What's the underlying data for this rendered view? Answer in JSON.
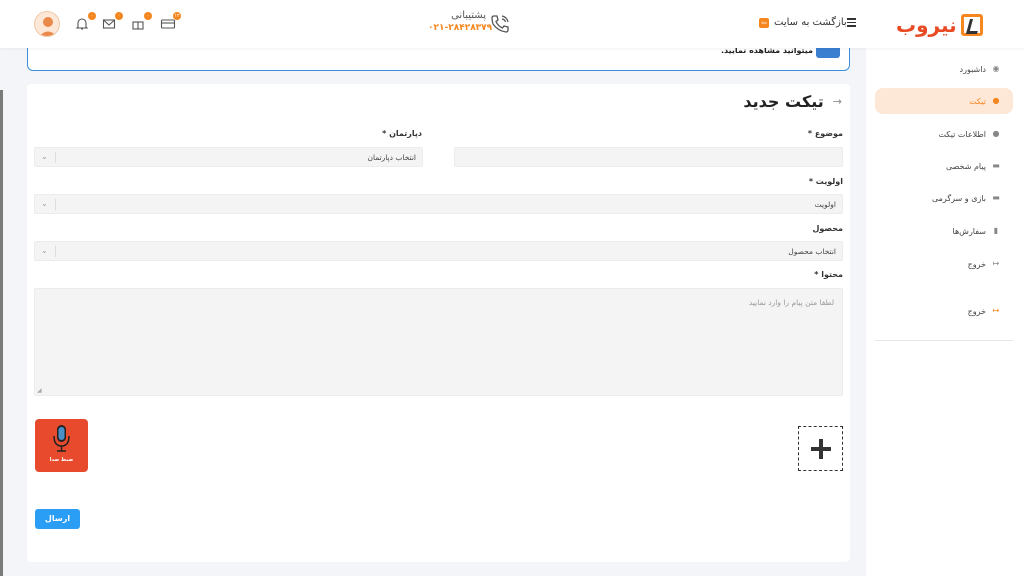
{
  "header": {
    "support_label": "پشتیبانی",
    "support_phone": "۰۲۱-۲۸۴۲۸۳۷۹",
    "back_to_site": "بازگشت به سایت",
    "logo_text": "نیروب",
    "badges": {
      "cart": "۱۲",
      "gift": "۰",
      "mail": "۰",
      "bell": "۰"
    }
  },
  "alert": {
    "text": "میتوانید مشاهده نمایید."
  },
  "sidebar": {
    "items": [
      {
        "label": "داشبورد",
        "icon": "dashboard-icon"
      },
      {
        "label": "تیکت",
        "icon": "ticket-icon"
      },
      {
        "label": "اطلاعات تیکت",
        "icon": "info-icon"
      },
      {
        "label": "پیام شخصی",
        "icon": "message-icon"
      },
      {
        "label": "بازی و سرگرمی",
        "icon": "gamepad-icon"
      },
      {
        "label": "سفارش‌ها",
        "icon": "orders-icon"
      },
      {
        "label": "خروج",
        "icon": "exit-icon"
      },
      {
        "label": "خروج",
        "icon": "exit-icon"
      }
    ]
  },
  "form": {
    "title": "تیکت جدید",
    "subject_label": "موضوع *",
    "subject_value": "",
    "department_label": "دپارتمان *",
    "department_value": "انتخاب دپارتمان",
    "priority_label": "اولویت *",
    "priority_value": "اولویت",
    "product_label": "محصول",
    "product_value": "انتخاب محصول",
    "content_label": "محتوا *",
    "content_placeholder": "لطفا متن پیام را وارد نمایید",
    "record_label": "ضبط صدا",
    "submit_label": "ارسال"
  },
  "colors": {
    "accent": "#f6861f",
    "primary": "#2a9df4",
    "record": "#e74a2c"
  }
}
